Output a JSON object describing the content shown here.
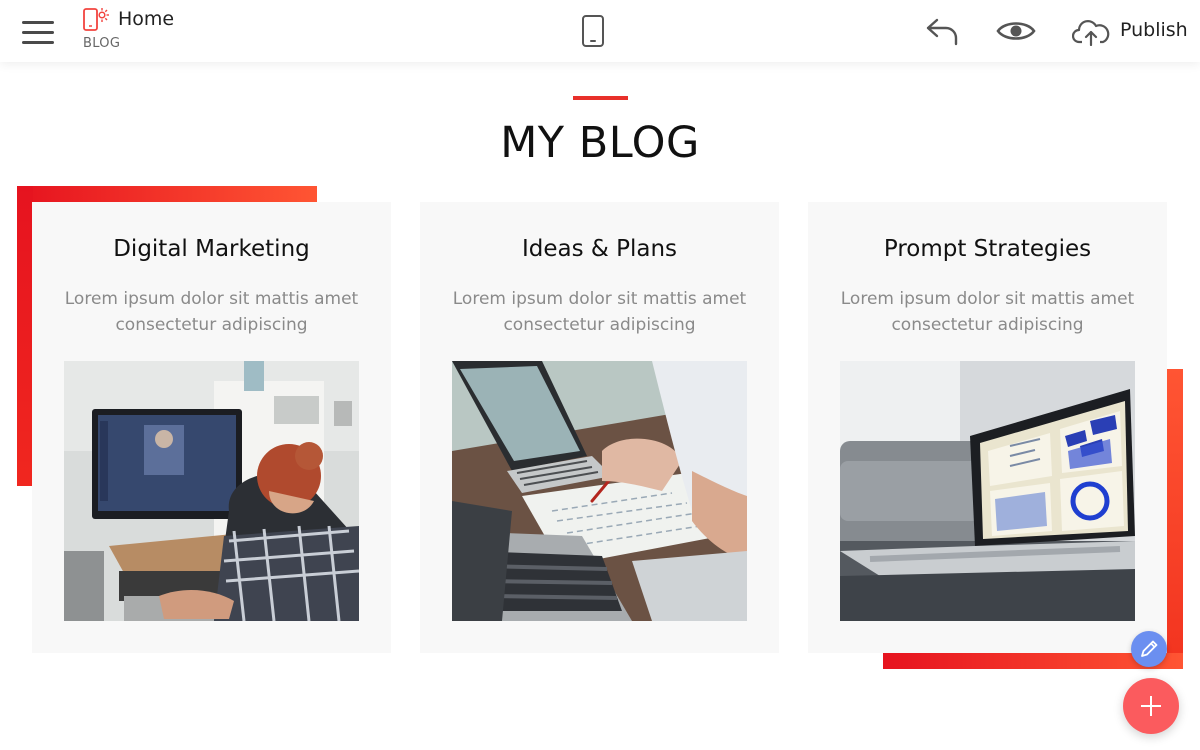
{
  "topbar": {
    "page_title": "Home",
    "page_subtitle": "BLOG",
    "publish_label": "Publish",
    "icons": [
      "menu-icon",
      "page-icon",
      "mobile-preview-icon",
      "undo-icon",
      "eye-icon",
      "cloud-upload-icon"
    ]
  },
  "section": {
    "title": "MY BLOG",
    "accent_color": "#e8302a"
  },
  "cards": [
    {
      "title": "Digital Marketing",
      "text": "Lorem ipsum dolor sit mattis amet consectetur adipiscing",
      "image": "photo-woman-at-computer"
    },
    {
      "title": "Ideas & Plans",
      "text": "Lorem ipsum dolor sit mattis amet consectetur adipiscing",
      "image": "photo-laptops-and-notes"
    },
    {
      "title": "Prompt Strategies",
      "text": "Lorem ipsum dolor sit mattis amet consectetur adipiscing",
      "image": "photo-laptop-with-charts"
    }
  ],
  "floating": {
    "edit_icon": "pencil-icon",
    "add_icon": "plus-icon",
    "edit_color": "#6b8ff0",
    "add_color": "#fb5b5e"
  },
  "colors": {
    "brand_gradient_start": "#e6131f",
    "brand_gradient_end": "#ff5533",
    "card_background": "#f8f8f8"
  }
}
